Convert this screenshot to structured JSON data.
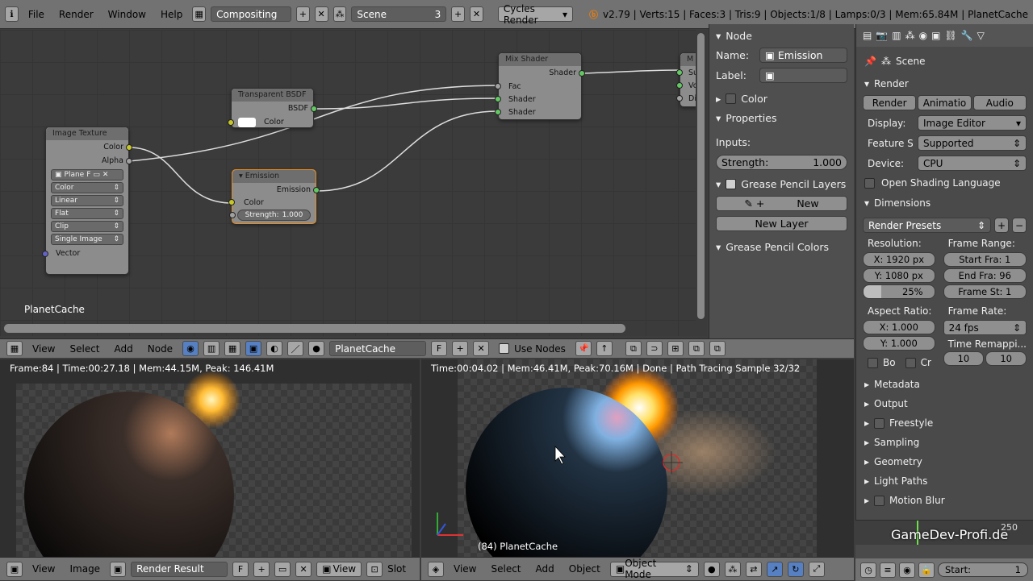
{
  "topbar": {
    "menus": [
      "File",
      "Render",
      "Window",
      "Help"
    ],
    "screen_layout": "Compositing",
    "scene": "Scene",
    "scene_users": "3",
    "engine": "Cycles Render",
    "stats": "v2.79 | Verts:15 | Faces:3 | Tris:9 | Objects:1/8 | Lamps:0/3 | Mem:65.84M | PlanetCache"
  },
  "node_editor": {
    "nodes": {
      "image_texture": {
        "title": "Image Texture",
        "out_color": "Color",
        "out_alpha": "Alpha",
        "image": "Plane",
        "image_flag": "F",
        "color_space": "Color",
        "interpolation": "Linear",
        "projection": "Flat",
        "extension": "Clip",
        "source": "Single Image",
        "in_vector": "Vector"
      },
      "transparent": {
        "title": "Transparent BSDF",
        "out": "BSDF",
        "in_color": "Color"
      },
      "emission": {
        "title": "Emission",
        "out": "Emission",
        "in_color": "Color",
        "strength": "Strength:",
        "strength_val": "1.000"
      },
      "mix": {
        "title": "Mix Shader",
        "out": "Shader",
        "fac": "Fac",
        "shader1": "Shader",
        "shader2": "Shader"
      },
      "partial": {
        "title": "M",
        "s1": "Su",
        "s2": "Vo",
        "s3": "Di"
      }
    },
    "material_label": "PlanetCache"
  },
  "node_panel": {
    "node_header": "Node",
    "name_label": "Name:",
    "name_value": "Emission",
    "label_label": "Label:",
    "label_value": "",
    "color_header": "Color",
    "properties_header": "Properties",
    "inputs_label": "Inputs:",
    "strength_label": "Strength:",
    "strength_value": "1.000",
    "gp_layers_header": "Grease Pencil Layers",
    "new_button": "New",
    "new_layer_button": "New Layer",
    "gp_colors_header": "Grease Pencil Colors"
  },
  "props": {
    "context": "Scene",
    "render_header": "Render",
    "tabs": [
      "Render",
      "Animatio",
      "Audio"
    ],
    "display_label": "Display:",
    "display_value": "Image Editor",
    "feature_label": "Feature S",
    "feature_value": "Supported",
    "device_label": "Device:",
    "device_value": "CPU",
    "osl_label": "Open Shading Language",
    "dimensions_header": "Dimensions",
    "presets": "Render Presets",
    "resolution_label": "Resolution:",
    "res_x": "X: 1920 px",
    "res_y": "Y: 1080 px",
    "res_pct": "25%",
    "frame_range_label": "Frame Range:",
    "start": "Start Fra: 1",
    "end": "End Fra: 96",
    "step": "Frame St: 1",
    "aspect_label": "Aspect Ratio:",
    "asp_x": "X:   1.000",
    "asp_y": "Y:   1.000",
    "frame_rate_label": "Frame Rate:",
    "fps": "24 fps",
    "remap_label": "Time Remappi...",
    "remap_old": "10",
    "remap_new": "10",
    "border_label": "Bo",
    "crop_label": "Cr",
    "sections": [
      "Metadata",
      "Output",
      "Freestyle",
      "Sampling",
      "Geometry",
      "Light Paths",
      "Motion Blur"
    ]
  },
  "ne_header": {
    "menus": [
      "View",
      "Select",
      "Add",
      "Node"
    ],
    "material": "PlanetCache",
    "flag": "F",
    "use_nodes": "Use Nodes"
  },
  "image_editor": {
    "info": "Frame:84 | Time:00:27.18 | Mem:44.15M, Peak: 146.41M",
    "menus": [
      "View",
      "Image"
    ],
    "image": "Render Result",
    "flag": "F",
    "view": "View",
    "slot": "Slot"
  },
  "viewport": {
    "info": "Time:00:04.02 | Mem:46.41M, Peak:70.16M | Done | Path Tracing Sample 32/32",
    "object_label": "(84) PlanetCache",
    "menus": [
      "View",
      "Select",
      "Add",
      "Object"
    ],
    "mode": "Object Mode"
  },
  "timeline": {
    "start": "Start:",
    "start_val": "1",
    "frame_250": "250",
    "watermark": "GameDev-Profi.de"
  }
}
